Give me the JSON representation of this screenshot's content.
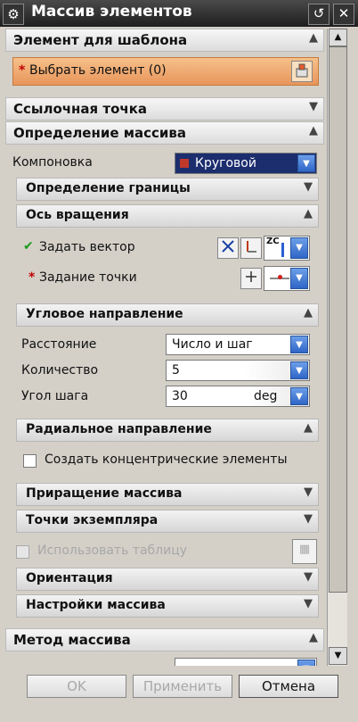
{
  "title": "Массив элементов",
  "sections": {
    "template": {
      "title": "Элемент для шаблона",
      "select_prompt": "Выбрать элемент (0)",
      "required_mark": "*"
    },
    "ref_point": {
      "title": "Ссылочная точка"
    },
    "array_def": {
      "title": "Определение массива",
      "layout_label": "Компоновка",
      "layout_value": "Круговой",
      "boundary": {
        "title": "Определение границы"
      },
      "axis": {
        "title": "Ось вращения",
        "vector_label": "Задать вектор",
        "vector_mark": "✔",
        "point_label": "Задание точки",
        "point_mark": "*",
        "zc_label": "ZC"
      },
      "angular": {
        "title": "Угловое направление",
        "distance_label": "Расстояние",
        "distance_value": "Число и шаг",
        "count_label": "Количество",
        "count_value": "5",
        "step_label": "Угол шага",
        "step_value": "30",
        "step_unit": "deg"
      },
      "radial": {
        "title": "Радиальное направление",
        "concentric_label": "Создать концентрические элементы"
      },
      "increment": {
        "title": "Приращение массива"
      },
      "instance": {
        "title": "Точки экземпляра"
      },
      "use_table_label": "Использовать таблицу",
      "orientation": {
        "title": "Ориентация"
      },
      "settings": {
        "title": "Настройки массива"
      }
    },
    "method": {
      "title": "Метод массива"
    }
  },
  "buttons": {
    "ok": "OK",
    "apply": "Применить",
    "cancel": "Отмена"
  },
  "colors": {
    "select_highlight": "#f0a35e",
    "title_bar": "#2a2a2a",
    "dropdown_blue": "#3b6fd0"
  }
}
